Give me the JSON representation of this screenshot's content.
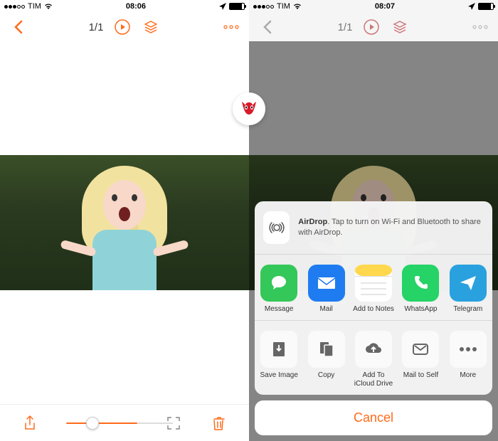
{
  "left": {
    "status": {
      "carrier": "TIM",
      "time": "08:06"
    },
    "nav": {
      "count": "1/1"
    }
  },
  "right": {
    "status": {
      "carrier": "TIM",
      "time": "08:07"
    },
    "nav": {
      "count": "1/1"
    }
  },
  "share": {
    "airdrop": {
      "title": "AirDrop",
      "text": ". Tap to turn on Wi-Fi and Bluetooth to share with AirDrop."
    },
    "apps": [
      {
        "label": "Message",
        "bg": "#34c759",
        "glyph": "bubble"
      },
      {
        "label": "Mail",
        "bg": "#1e7cf0",
        "glyph": "envelope"
      },
      {
        "label": "Add to Notes",
        "bg": "#fff",
        "glyph": "notes"
      },
      {
        "label": "WhatsApp",
        "bg": "#25d366",
        "glyph": "phone"
      },
      {
        "label": "Telegram",
        "bg": "#2aa1df",
        "glyph": "plane"
      }
    ],
    "actions": [
      {
        "label": "Save Image",
        "glyph": "save"
      },
      {
        "label": "Copy",
        "glyph": "copy"
      },
      {
        "label": "Add To iCloud Drive",
        "glyph": "cloud"
      },
      {
        "label": "Mail to Self",
        "glyph": "mailself"
      },
      {
        "label": "More",
        "glyph": "more"
      }
    ],
    "cancel": "Cancel"
  }
}
